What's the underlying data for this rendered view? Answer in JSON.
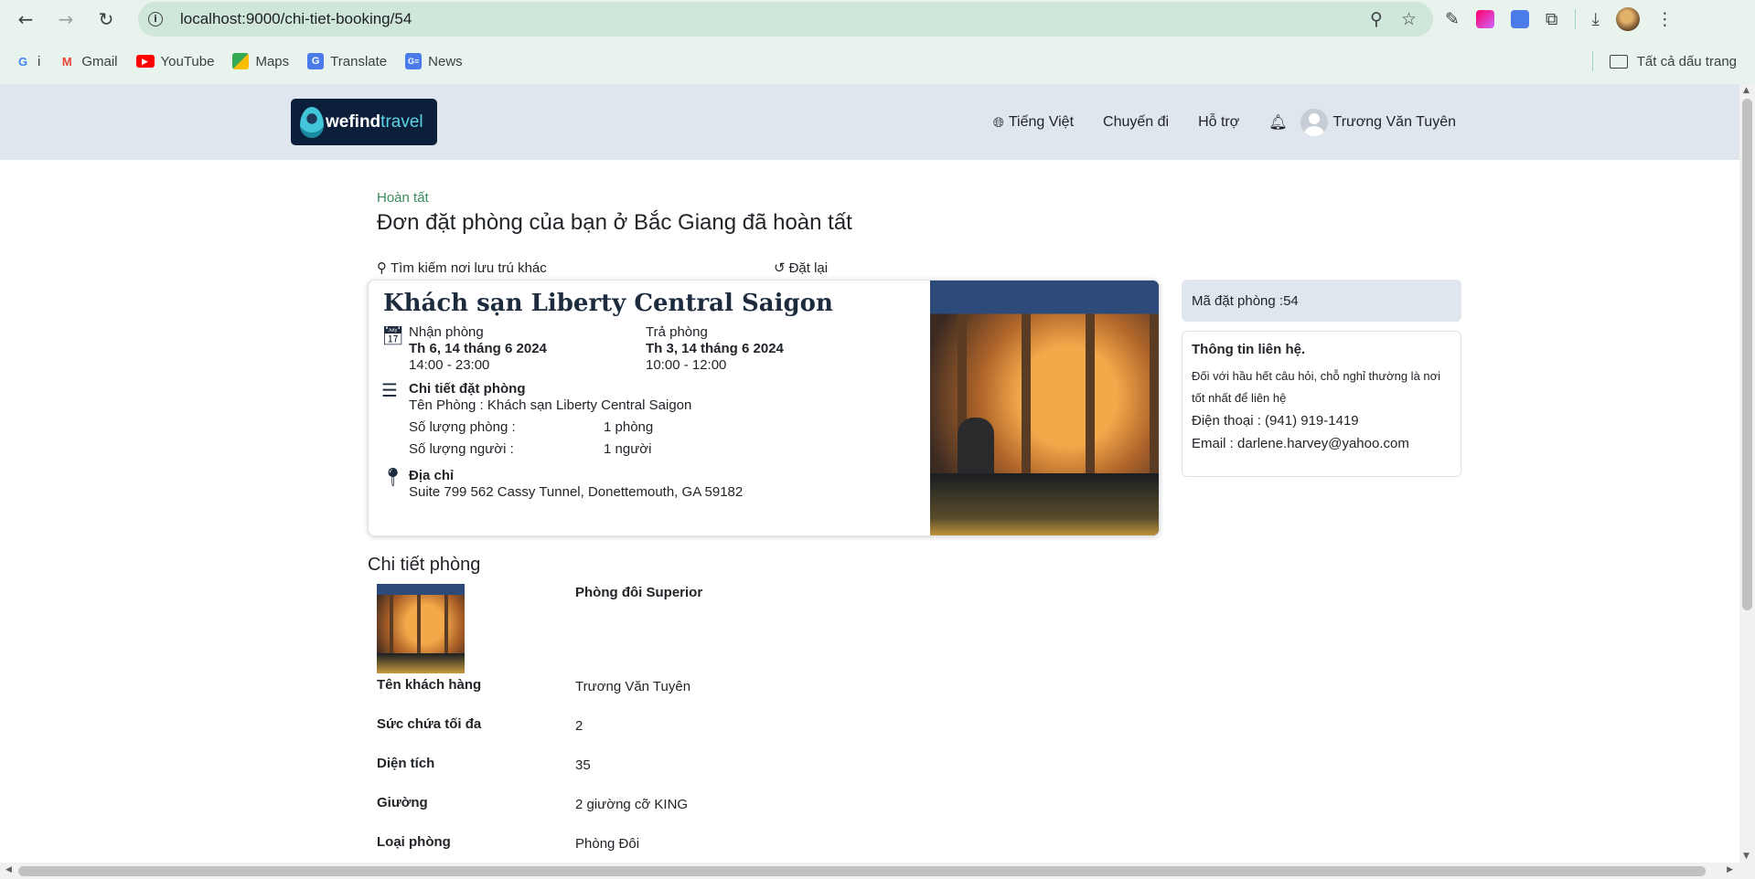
{
  "browser": {
    "url": "localhost:9000/chi-tiet-booking/54",
    "bookmarks": [
      {
        "label": "i",
        "icon": "google-icon"
      },
      {
        "label": "Gmail",
        "icon": "gmail-icon"
      },
      {
        "label": "YouTube",
        "icon": "youtube-icon"
      },
      {
        "label": "Maps",
        "icon": "maps-icon"
      },
      {
        "label": "Translate",
        "icon": "translate-icon"
      },
      {
        "label": "News",
        "icon": "news-icon"
      }
    ],
    "all_bookmarks": "Tất cả dấu trang"
  },
  "header": {
    "logo_brand": "wefind",
    "logo_suffix": "travel",
    "language": "Tiếng Việt",
    "trips": "Chuyến đi",
    "support": "Hỗ trợ",
    "user_name": "Trương Văn Tuyên"
  },
  "status": "Hoàn tất",
  "title": "Đơn đặt phòng của bạn ở Bắc Giang đã hoàn tất",
  "actions": {
    "search_other": "Tìm kiếm nơi lưu trú khác",
    "rebook": "Đặt lại"
  },
  "booking": {
    "hotel_name": "Khách sạn Liberty Central Saigon",
    "checkin_label": "Nhận phòng",
    "checkin_date": "Th 6, 14 tháng 6 2024",
    "checkin_time": "14:00 - 23:00",
    "checkout_label": "Trả phòng",
    "checkout_date": "Th 3, 14 tháng 6 2024",
    "checkout_time": "10:00 - 12:00",
    "details_label": "Chi tiết đặt phòng",
    "room_name_line": "Tên Phòng : Khách sạn Liberty Central Saigon",
    "rooms_label": "Số lượng phòng :",
    "rooms_value": "1 phòng",
    "people_label": "Số lượng người :",
    "people_value": "1 người",
    "address_label": "Địa chỉ",
    "address_value": "Suite 799 562 Cassy Tunnel, Donettemouth, GA 59182"
  },
  "sidebar": {
    "booking_code": "Mã đặt phòng :54",
    "contact_title": "Thông tin liên hệ.",
    "contact_desc": "Đối với hầu hết câu hỏi, chỗ nghỉ thường là nơi tốt nhất để liên hệ",
    "phone": "Điện thoại : (941) 919-1419",
    "email": "Email : darlene.harvey@yahoo.com"
  },
  "room": {
    "section_title": "Chi tiết phòng",
    "room_type_name": "Phòng đôi Superior",
    "rows": [
      {
        "label": "Tên khách hàng",
        "value": "Trương Văn Tuyên"
      },
      {
        "label": "Sức chứa tối đa",
        "value": "2"
      },
      {
        "label": "Diện tích",
        "value": "35"
      },
      {
        "label": "Giường",
        "value": "2 giường cỡ KING"
      },
      {
        "label": "Loại phòng",
        "value": "Phòng Đôi"
      }
    ]
  }
}
